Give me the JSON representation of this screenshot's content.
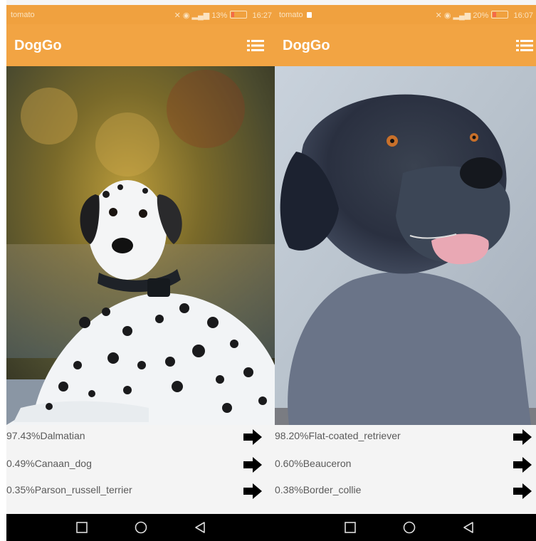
{
  "left_phone": {
    "status": {
      "carrier": "tomato",
      "signal": "13%",
      "time": "16:27",
      "battery_level": 0.13
    },
    "app_title": "DogGo",
    "menu_icon": "list-menu-icon",
    "photo_subject": "dalmatian-photo",
    "results": [
      {
        "text": "97.43%Dalmatian"
      },
      {
        "text": "0.49%Canaan_dog"
      },
      {
        "text": "0.35%Parson_russell_terrier"
      }
    ],
    "nav": [
      "square-recents-icon",
      "circle-home-icon",
      "triangle-back-icon"
    ]
  },
  "right_phone": {
    "status": {
      "carrier": "tomato",
      "signal": "20%",
      "time": "16:07",
      "battery_level": 0.2
    },
    "app_title": "DogGo",
    "menu_icon": "list-menu-icon",
    "photo_subject": "flat-coated-retriever-photo",
    "results": [
      {
        "text": "98.20%Flat-coated_retriever"
      },
      {
        "text": "0.60%Beauceron"
      },
      {
        "text": "0.38%Border_collie"
      }
    ],
    "nav": [
      "square-recents-icon",
      "circle-home-icon",
      "triangle-back-icon"
    ]
  },
  "colors": {
    "accent": "#f2a443",
    "navbar": "#000000",
    "result_text": "#5a5a5a"
  }
}
